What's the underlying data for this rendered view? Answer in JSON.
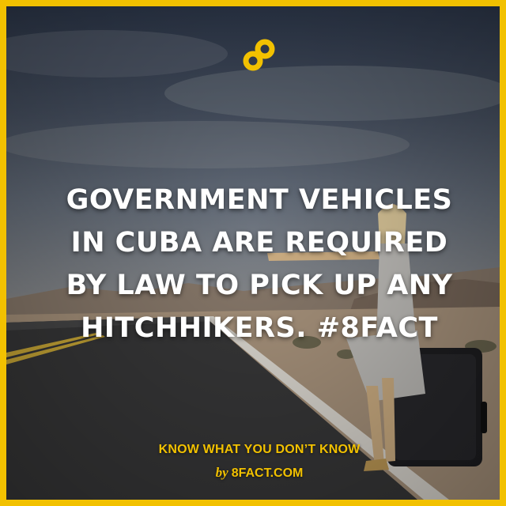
{
  "headline": {
    "line1": "GOVERNMENT VEHICLES",
    "line2": "IN CUBA ARE REQUIRED",
    "line3": "BY LAW TO PICK UP ANY",
    "line4": "HITCHHIKERS. #8FACT"
  },
  "footer": {
    "tagline": "KNOW WHAT YOU DON’T KNOW",
    "by": "by",
    "site": "8FACT.COM"
  },
  "colors": {
    "accent": "#f2c100",
    "text": "#ffffff"
  },
  "icons": {
    "logo": "8fact-logo-icon"
  }
}
